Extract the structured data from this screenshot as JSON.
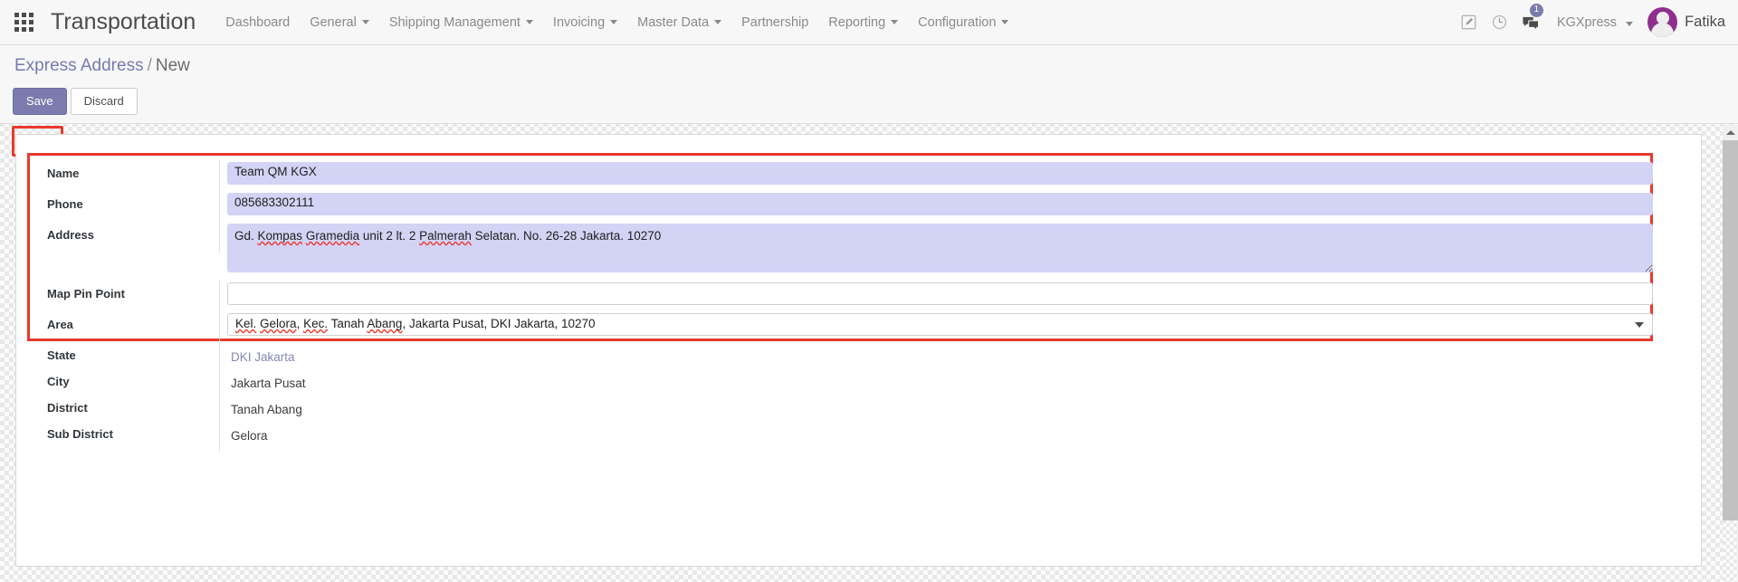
{
  "navbar": {
    "apps_icon": "apps-grid-icon",
    "brand": "Transportation",
    "menu": [
      {
        "label": "Dashboard",
        "has_dropdown": false
      },
      {
        "label": "General",
        "has_dropdown": true
      },
      {
        "label": "Shipping Management",
        "has_dropdown": true
      },
      {
        "label": "Invoicing",
        "has_dropdown": true
      },
      {
        "label": "Master Data",
        "has_dropdown": true
      },
      {
        "label": "Partnership",
        "has_dropdown": false
      },
      {
        "label": "Reporting",
        "has_dropdown": true
      },
      {
        "label": "Configuration",
        "has_dropdown": true
      }
    ],
    "icons": {
      "edit": "edit-pencil-square-icon",
      "clock": "clock-icon",
      "messages": "chat-bubbles-icon"
    },
    "message_count": "1",
    "company": "KGXpress",
    "user": "Fatika",
    "avatar": "user-avatar"
  },
  "control_panel": {
    "breadcrumb_root": "Express Address",
    "breadcrumb_sep": "/",
    "breadcrumb_current": "New",
    "save_label": "Save",
    "discard_label": "Discard"
  },
  "form": {
    "fields": [
      {
        "label": "Name",
        "value": "Team QM KGX",
        "type": "text",
        "state": "editable"
      },
      {
        "label": "Phone",
        "value": "085683302111",
        "type": "text",
        "state": "editable"
      },
      {
        "label": "Address",
        "value": "Gd. Kompas Gramedia unit 2 lt. 2 Palmerah Selatan. No. 26-28 Jakarta. 10270",
        "type": "textarea",
        "state": "editable",
        "misspelled": [
          "Kompas",
          "Gramedia",
          "Palmerah"
        ]
      },
      {
        "label": "Map Pin Point",
        "value": "",
        "placeholder": "",
        "type": "text",
        "state": "empty"
      },
      {
        "label": "Area",
        "value": "Kel. Gelora, Kec. Tanah Abang, Jakarta Pusat, DKI Jakarta, 10270",
        "type": "select",
        "state": "focused",
        "misspelled": [
          "Kel.",
          "Gelora",
          "Kec.",
          "Abang"
        ]
      },
      {
        "label": "State",
        "value": "DKI Jakarta",
        "type": "readonly-link"
      },
      {
        "label": "City",
        "value": "Jakarta Pusat",
        "type": "readonly"
      },
      {
        "label": "District",
        "value": "Tanah Abang",
        "type": "readonly"
      },
      {
        "label": "Sub District",
        "value": "Gelora",
        "type": "readonly"
      }
    ]
  },
  "annotations": {
    "highlight_color": "#e8392e",
    "save_button_highlight": true,
    "editable_fields_highlight": true
  },
  "colors": {
    "accent_purple": "#7c7bad",
    "input_fill": "#d3d3f5",
    "avatar_purple": "#8e2f8e",
    "navbar_bg": "#f7f7f7",
    "annotation_red": "#e8392e"
  },
  "scrollbar": {
    "up_arrow": "scroll-up-arrow-icon"
  }
}
